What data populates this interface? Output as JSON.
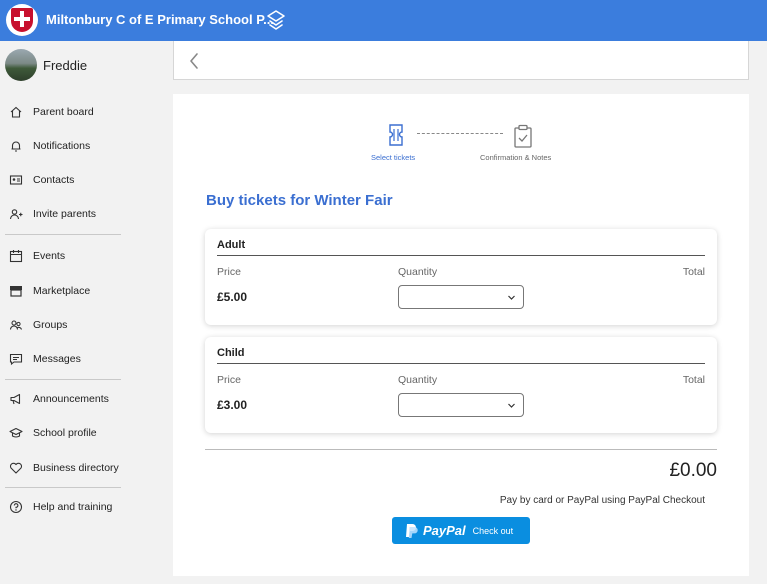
{
  "header": {
    "school_name": "Miltonbury C of E Primary School P..."
  },
  "user": {
    "name": "Freddie"
  },
  "sidebar": {
    "items": [
      {
        "label": "Parent board",
        "icon": "home-icon"
      },
      {
        "label": "Notifications",
        "icon": "bell-icon"
      },
      {
        "label": "Contacts",
        "icon": "contact-card-icon"
      },
      {
        "label": "Invite parents",
        "icon": "add-user-icon"
      },
      {
        "label": "Events",
        "icon": "calendar-icon"
      },
      {
        "label": "Marketplace",
        "icon": "shop-icon"
      },
      {
        "label": "Groups",
        "icon": "group-icon"
      },
      {
        "label": "Messages",
        "icon": "message-icon"
      },
      {
        "label": "Announcements",
        "icon": "megaphone-icon"
      },
      {
        "label": "School profile",
        "icon": "graduation-cap-icon"
      },
      {
        "label": "Business directory",
        "icon": "heart-icon"
      },
      {
        "label": "Help and training",
        "icon": "help-icon"
      }
    ]
  },
  "stepper": {
    "steps": [
      {
        "label": "Select tickets",
        "active": true
      },
      {
        "label": "Confirmation & Notes",
        "active": false
      }
    ]
  },
  "main": {
    "title": "Buy tickets for Winter Fair",
    "headers": {
      "price": "Price",
      "quantity": "Quantity",
      "total": "Total"
    },
    "tickets": [
      {
        "name": "Adult",
        "price": "£5.00",
        "quantity": ""
      },
      {
        "name": "Child",
        "price": "£3.00",
        "quantity": ""
      }
    ],
    "grand_total": "£0.00",
    "pay_note": "Pay by card or PayPal using PayPal Checkout",
    "paypal": {
      "brand": "PayPal",
      "label": "Check out"
    }
  },
  "colors": {
    "header": "#3b7ddd",
    "accent": "#3b6fd1",
    "paypal": "#0a8ee0"
  }
}
